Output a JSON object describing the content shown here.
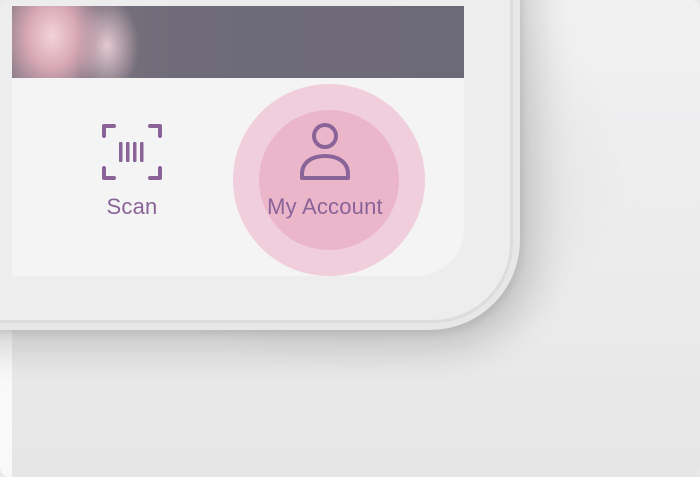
{
  "nav": {
    "items": [
      {
        "label": "Scan",
        "icon": "barcode-scan-icon"
      },
      {
        "label": "My Account",
        "icon": "person-icon",
        "active": true
      }
    ]
  },
  "colors": {
    "accent": "#8a6498",
    "ripple": "#ec9fbd",
    "nav_background": "#f4f4f4"
  }
}
